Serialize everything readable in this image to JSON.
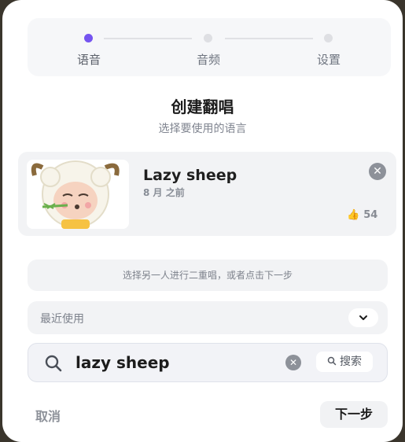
{
  "stepper": {
    "steps": [
      {
        "label": "语音",
        "state": "active"
      },
      {
        "label": "音频",
        "state": "inactive"
      },
      {
        "label": "设置",
        "state": "inactive"
      }
    ],
    "active_color": "#7554f0"
  },
  "header": {
    "title": "创建翻唱",
    "subtitle": "选择要使用的语言"
  },
  "voice_card": {
    "name": "Lazy sheep",
    "time": "8 月 之前",
    "likes": "54",
    "close_icon": "close-icon",
    "thumbnail_icon": "sheep-cartoon-image"
  },
  "hint": "选择另一人进行二重唱，或者点击下一步",
  "recent": {
    "label": "最近使用",
    "icon": "chevron-down-icon"
  },
  "search": {
    "value": "lazy sheep",
    "button_label": "搜索"
  },
  "footer": {
    "cancel_label": "取消",
    "next_label": "下一步"
  }
}
